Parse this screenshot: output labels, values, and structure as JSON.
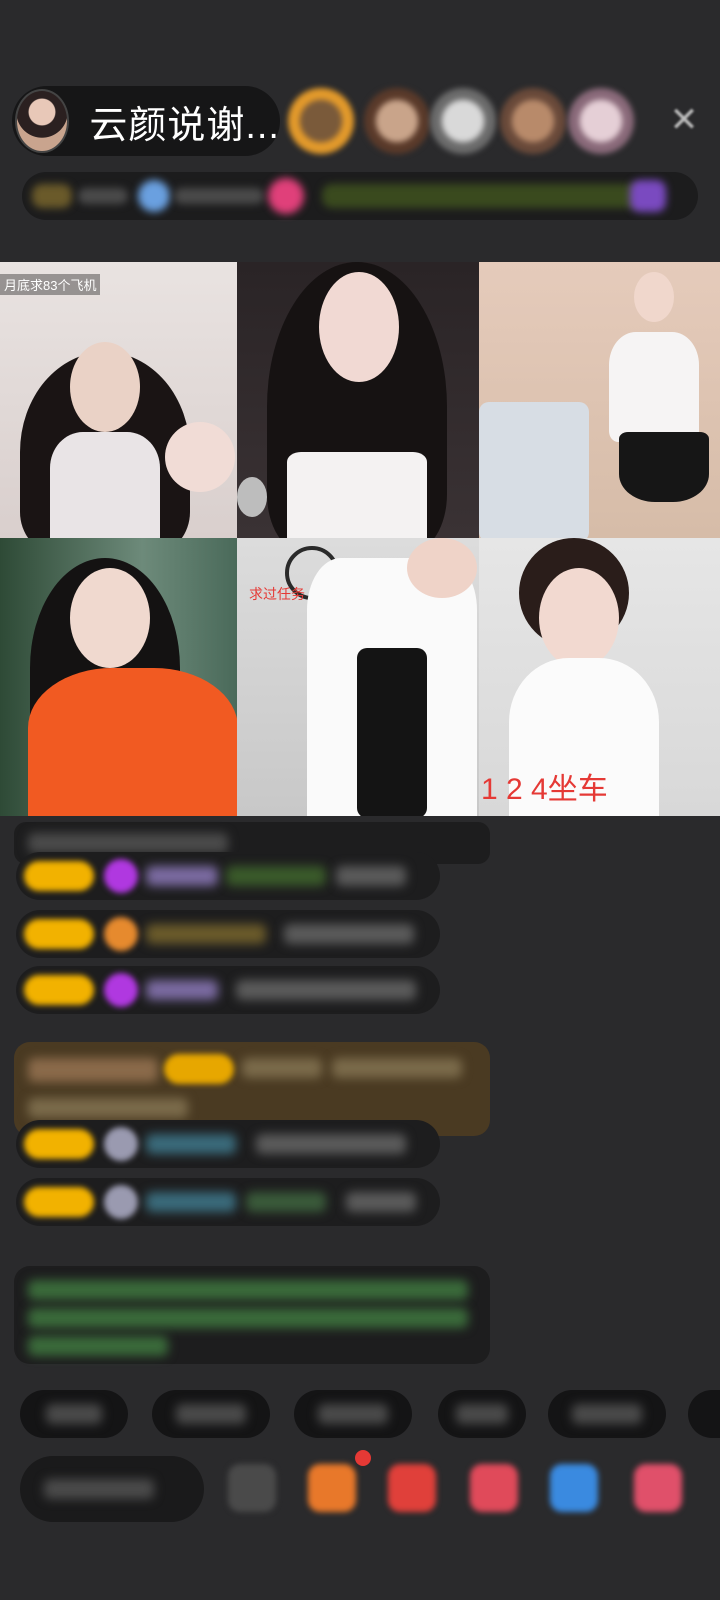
{
  "header": {
    "host_name": "云颜说谢...",
    "close_icon": "close-icon"
  },
  "grid": {
    "cells": [
      {
        "tag": "月底求83个飞机",
        "label": ""
      },
      {
        "tag": "",
        "label": ""
      },
      {
        "tag": "",
        "label": ""
      },
      {
        "tag": "",
        "label": ""
      },
      {
        "tag": "",
        "label": "求过任务"
      },
      {
        "tag": "",
        "label": "1 2 4坐车"
      }
    ]
  },
  "colors": {
    "background": "#2a2a2c",
    "chat_bubble": "#1d1d1e",
    "level_badge": "#f2b200",
    "highlight": "#4a3a22",
    "label_red": "#e53935"
  }
}
